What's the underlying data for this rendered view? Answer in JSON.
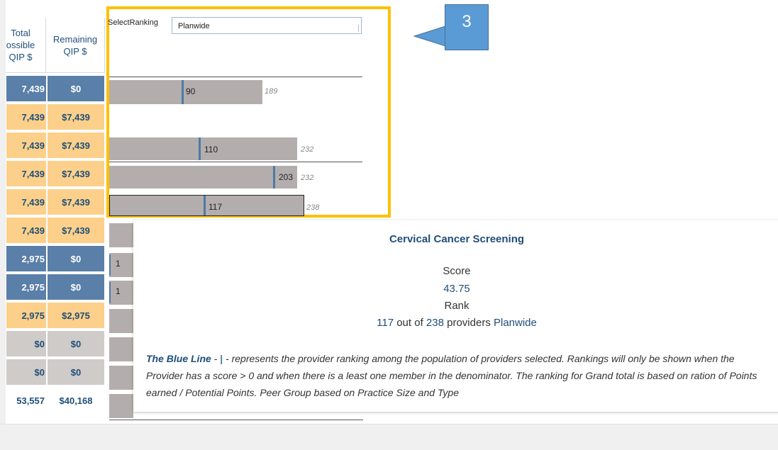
{
  "table": {
    "header_total": "Total\nossible\nQIP $",
    "header_remaining": "Remaining\nQIP $",
    "rows": [
      {
        "total": " 7,439",
        "remaining": "$0",
        "style": "blue"
      },
      {
        "total": " 7,439",
        "remaining": "$7,439",
        "style": "orange"
      },
      {
        "total": " 7,439",
        "remaining": "$7,439",
        "style": "orange"
      },
      {
        "total": " 7,439",
        "remaining": "$7,439",
        "style": "orange"
      },
      {
        "total": " 7,439",
        "remaining": "$7,439",
        "style": "orange"
      },
      {
        "total": " 7,439",
        "remaining": "$7,439",
        "style": "orange"
      },
      {
        "total": "2,975",
        "remaining": "$0",
        "style": "blue"
      },
      {
        "total": "2,975",
        "remaining": "$0",
        "style": "blue"
      },
      {
        "total": "2,975",
        "remaining": "$2,975",
        "style": "orange"
      },
      {
        "total": "$0",
        "remaining": "$0",
        "style": "gray"
      },
      {
        "total": "$0",
        "remaining": "$0",
        "style": "gray"
      },
      {
        "total": "53,557",
        "remaining": "$40,168",
        "style": "total"
      }
    ]
  },
  "filter": {
    "label": "SelectRanking",
    "value": "Planwide"
  },
  "bars": [
    {
      "value": "90",
      "max": "189",
      "outlined": false
    },
    {
      "value": "110",
      "max": "232",
      "outlined": false
    },
    {
      "value": "203",
      "max": "232",
      "outlined": false
    },
    {
      "value": "117",
      "max": "238",
      "outlined": true
    }
  ],
  "lower_ranks": [
    "1",
    "1"
  ],
  "callout": {
    "number": "3"
  },
  "tooltip": {
    "title": "Cervical Cancer Screening",
    "score_label": "Score",
    "score_value": "43.75",
    "rank_label": "Rank",
    "rank_value": "117",
    "rank_out_of": "out of",
    "rank_total": "238",
    "rank_providers": "providers",
    "rank_scope": "Planwide",
    "blue_line_label": "The Blue Line",
    "blue_line_dash": " - ",
    "blue_line_pipe": "|",
    "blue_line_text": " - represents the provider ranking among the population of providers selected. Rankings will only be shown when the Provider has a score > 0 and when there is a least one member in the denominator. The ranking for Grand total is based on ration of Points earned / Potential Points. Peer Group based on Practice Size and Type"
  },
  "colors": {
    "highlight": "#ffc000",
    "rank_line": "#4e79a7",
    "callout": "#5b9bd5",
    "blue_row": "#5a7fa8",
    "orange_row": "#fcd08a"
  }
}
